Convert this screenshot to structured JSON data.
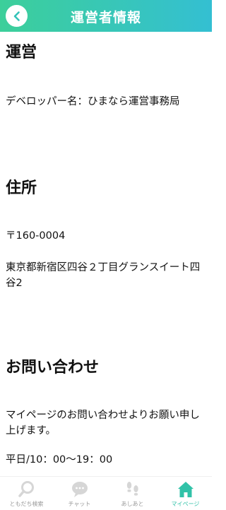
{
  "header": {
    "title": "運営者情報"
  },
  "sections": [
    {
      "title": "運営",
      "lines": [
        "デベロッパー名：ひまなら運営事務局"
      ]
    },
    {
      "title": "住所",
      "lines": [
        "〒160-0004",
        "東京都新宿区四谷２丁目グランスイート四谷2"
      ]
    },
    {
      "title": "お問い合わせ",
      "lines": [
        "マイページのお問い合わせよりお願い申し上げます。",
        "平日/10：00〜19：00"
      ]
    }
  ],
  "tabbar": {
    "items": [
      {
        "label": "ともだち検索",
        "icon": "search-icon",
        "active": false
      },
      {
        "label": "チャット",
        "icon": "chat-bubble-icon",
        "active": false
      },
      {
        "label": "あしあと",
        "icon": "footprints-icon",
        "active": false
      },
      {
        "label": "マイページ",
        "icon": "home-icon",
        "active": true
      }
    ]
  },
  "colors": {
    "accent": "#31c2a8",
    "header_start": "#3ccf9a",
    "header_end": "#34bfd2",
    "inactive_icon": "#d6d6d6"
  }
}
